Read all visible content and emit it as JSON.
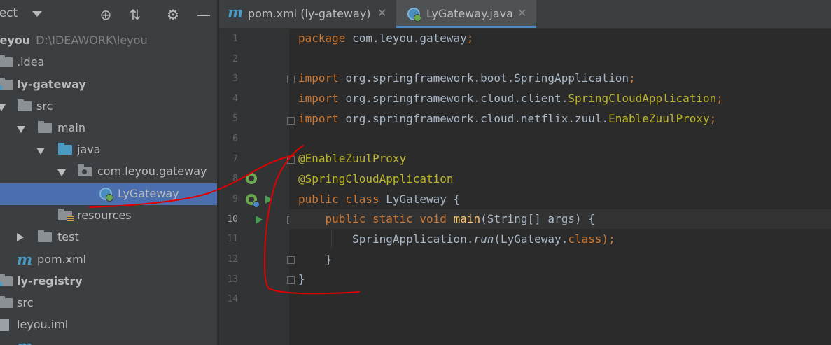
{
  "sidebar": {
    "title": "ject",
    "icons": [
      "crosshair-icon",
      "collapse-icon",
      "gear-icon",
      "minimize-icon"
    ],
    "tree": [
      {
        "name": "leyou",
        "hint": "D:\\IDEAWORK\\leyou",
        "bold": true
      },
      {
        "name": ".idea"
      },
      {
        "name": "ly-gateway",
        "bold": true
      },
      {
        "name": "src"
      },
      {
        "name": "main"
      },
      {
        "name": "java"
      },
      {
        "name": "com.leyou.gateway"
      },
      {
        "name": "LyGateway",
        "selected": true
      },
      {
        "name": "resources"
      },
      {
        "name": "test"
      },
      {
        "name": "pom.xml"
      },
      {
        "name": "ly-registry",
        "bold": true
      },
      {
        "name": "src"
      },
      {
        "name": "leyou.iml"
      }
    ]
  },
  "tabs": [
    {
      "label": "pom.xml (ly-gateway)",
      "close": "✕",
      "icon": "maven-icon"
    },
    {
      "label": "LyGateway.java",
      "close": "✕",
      "icon": "spring-class-icon",
      "active": true
    }
  ],
  "editor": {
    "current_line": 10,
    "line_numbers": [
      "1",
      "2",
      "3",
      "4",
      "5",
      "6",
      "7",
      "8",
      "9",
      "10",
      "11",
      "12",
      "13",
      "14"
    ],
    "lines": [
      [
        {
          "t": "package ",
          "c": "kw"
        },
        {
          "t": "com.leyou.gateway"
        },
        {
          "t": ";",
          "c": "kw"
        }
      ],
      [],
      [
        {
          "t": "import ",
          "c": "kw"
        },
        {
          "t": "org.springframework.boot.SpringApplication"
        },
        {
          "t": ";",
          "c": "kw"
        }
      ],
      [
        {
          "t": "import ",
          "c": "kw"
        },
        {
          "t": "org.springframework.cloud.client."
        },
        {
          "t": "SpringCloudApplication",
          "c": "ann"
        },
        {
          "t": ";",
          "c": "kw"
        }
      ],
      [
        {
          "t": "import ",
          "c": "kw"
        },
        {
          "t": "org.springframework.cloud.netflix.zuul."
        },
        {
          "t": "EnableZuulProxy",
          "c": "ann"
        },
        {
          "t": ";",
          "c": "kw"
        }
      ],
      [],
      [
        {
          "t": "@EnableZuulProxy",
          "c": "ann"
        }
      ],
      [
        {
          "t": "@SpringCloudApplication",
          "c": "ann"
        }
      ],
      [
        {
          "t": "public class ",
          "c": "kw"
        },
        {
          "t": "LyGateway "
        },
        {
          "t": "{"
        }
      ],
      [
        {
          "t": "    "
        },
        {
          "t": "public static void ",
          "c": "kw"
        },
        {
          "t": "main",
          "c": "mth"
        },
        {
          "t": "(String[] args) {"
        }
      ],
      [
        {
          "t": "        SpringApplication."
        },
        {
          "t": "run",
          "c": "it"
        },
        {
          "t": "(LyGateway."
        },
        {
          "t": "class",
          "c": "kw"
        },
        {
          "t": ");",
          "c": "kw"
        }
      ],
      [
        {
          "t": "    }"
        }
      ],
      [
        {
          "t": "}"
        }
      ],
      []
    ]
  },
  "colors": {
    "annotation_ink": "#e00000",
    "selection": "#4b6eaf",
    "keyword": "#cc7832",
    "annotation": "#bbb529",
    "method": "#ffc66d"
  }
}
